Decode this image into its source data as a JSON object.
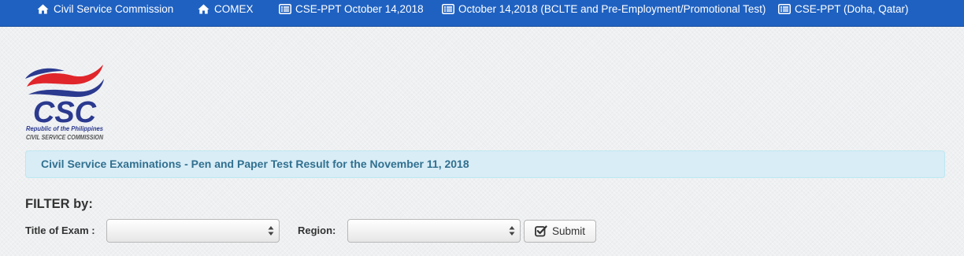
{
  "nav": {
    "items": [
      {
        "label": "Civil Service Commission",
        "icon": "home-icon"
      },
      {
        "label": "COMEX",
        "icon": "home-icon"
      },
      {
        "label": "CSE-PPT October 14,2018",
        "icon": "list-icon"
      },
      {
        "label": "October 14,2018 (BCLTE and Pre-Employment/Promotional Test)",
        "icon": "list-icon"
      },
      {
        "label": "CSE-PPT (Doha, Qatar)",
        "icon": "list-icon"
      }
    ]
  },
  "logo": {
    "mark": "CSC",
    "line1": "Republic of the Philippines",
    "line2": "CIVIL SERVICE COMMISSION"
  },
  "alert": {
    "text": "Civil Service Examinations - Pen and Paper Test Result for the November 11, 2018"
  },
  "filter": {
    "title": "FILTER by:",
    "exam_label": "Title of Exam :",
    "exam_value": "",
    "region_label": "Region:",
    "region_value": "",
    "submit_label": "Submit"
  },
  "colors": {
    "nav_bg": "#1f61c1",
    "alert_bg": "#d9edf7",
    "alert_text": "#31708f",
    "logo_blue": "#2b3a8f",
    "logo_red": "#e0262b"
  }
}
